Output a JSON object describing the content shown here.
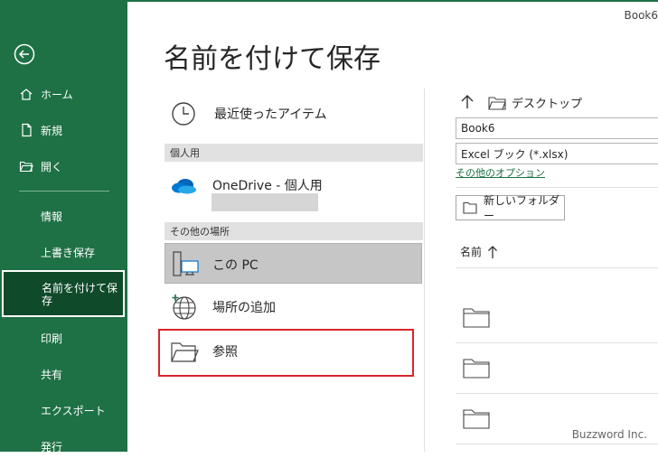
{
  "window": {
    "doc_title": "Book6"
  },
  "sidebar": {
    "items": [
      {
        "label": "ホーム",
        "icon": "home-icon"
      },
      {
        "label": "新規",
        "icon": "new-document-icon"
      },
      {
        "label": "開く",
        "icon": "open-folder-icon"
      },
      {
        "label": "情報"
      },
      {
        "label": "上書き保存"
      },
      {
        "label": "名前を付けて保存",
        "selected": true
      },
      {
        "label": "印刷"
      },
      {
        "label": "共有"
      },
      {
        "label": "エクスポート"
      },
      {
        "label": "発行"
      }
    ]
  },
  "main": {
    "title": "名前を付けて保存",
    "locations": {
      "recent": "最近使ったアイテム",
      "personal_header": "個人用",
      "onedrive": "OneDrive - 個人用",
      "other_header": "その他の場所",
      "this_pc": "この PC",
      "add_place": "場所の追加",
      "browse": "参照"
    }
  },
  "save_panel": {
    "path": "デスクトップ",
    "filename": "Book6",
    "filetype": "Excel ブック (*.xlsx)",
    "more_options": "その他のオプション",
    "new_folder": "新しいフォルダー",
    "column_name": "名前"
  },
  "watermark": "Buzzword Inc.",
  "colors": {
    "sidebar": "#1e7145",
    "selected": "#0f4a2a",
    "highlight_box": "#d9262c"
  }
}
